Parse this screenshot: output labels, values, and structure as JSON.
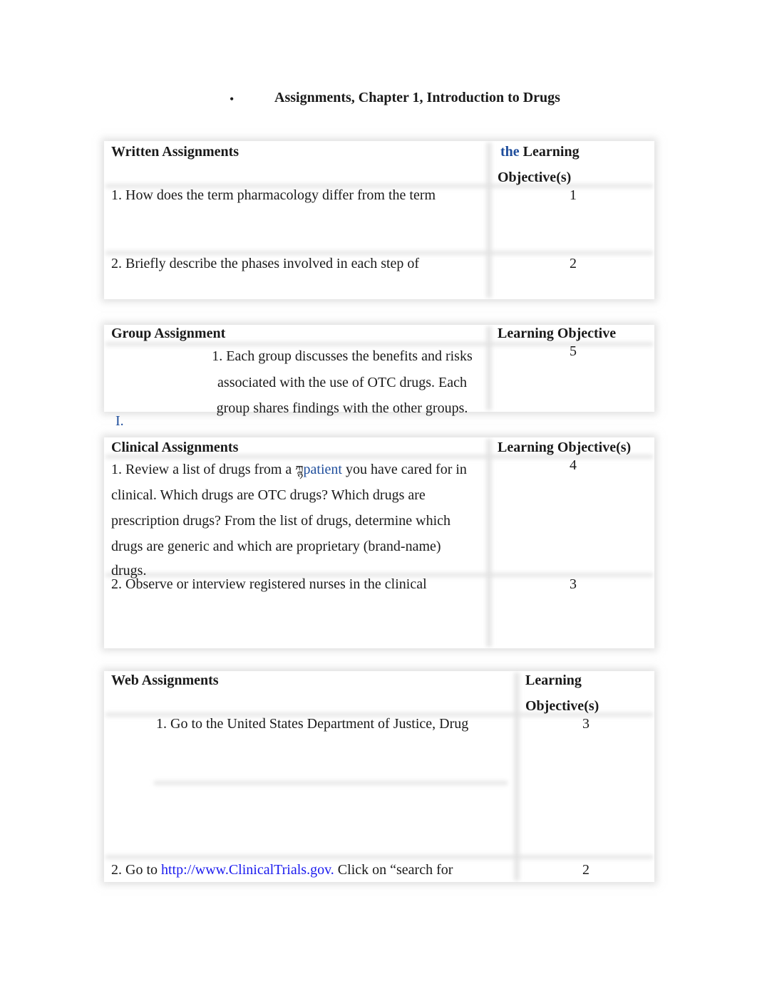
{
  "document": {
    "bullet": "•",
    "title": "Assignments, Chapter 1, Introduction to Drugs"
  },
  "written": {
    "header": "Written Assignments",
    "lo_header_prefix": "the",
    "lo_header_line1": " Learning",
    "lo_header_line2": "Objective(s)",
    "rows": [
      {
        "text": "1. How does the term pharmacology differ from the term",
        "objective": "1"
      },
      {
        "text": "2. Briefly describe the phases involved in each step of",
        "objective": "2"
      }
    ]
  },
  "group": {
    "header": "Group Assignment",
    "lo_header": "Learning Objective",
    "rows": [
      {
        "lines": [
          "1. Each group discusses the benefits and risks",
          "associated with the use of OTC drugs. Each",
          "group shares findings with the other groups."
        ],
        "objective": "5"
      }
    ]
  },
  "marker": "I.",
  "clinical": {
    "header": "Clinical Assignments",
    "lo_header": "Learning Objective(s)",
    "rows": [
      {
        "line1_before": "1. Review a list of drugs from a ",
        "inline_glyph": "ཀྙ",
        "line1_link": "patient",
        "line1_after": " you have cared for in",
        "lines": [
          "clinical. Which drugs are OTC drugs? Which drugs are",
          "prescription drugs? From the list of drugs, determine which",
          "drugs are generic and which are proprietary (brand-name)",
          "drugs."
        ],
        "objective": "4"
      },
      {
        "text": "2. Observe or interview registered nurses in the clinical",
        "objective": "3"
      }
    ]
  },
  "web": {
    "header": "Web Assignments",
    "lo_header_line1": "Learning",
    "lo_header_line2": "Objective(s)",
    "rows": [
      {
        "text": "1. Go to the United States Department of Justice, Drug",
        "objective": "3"
      },
      {
        "text_before": "2. Go to ",
        "link": "http://www.ClinicalTrials.gov.",
        "text_after": " Click on “search for",
        "objective": "2"
      }
    ]
  }
}
